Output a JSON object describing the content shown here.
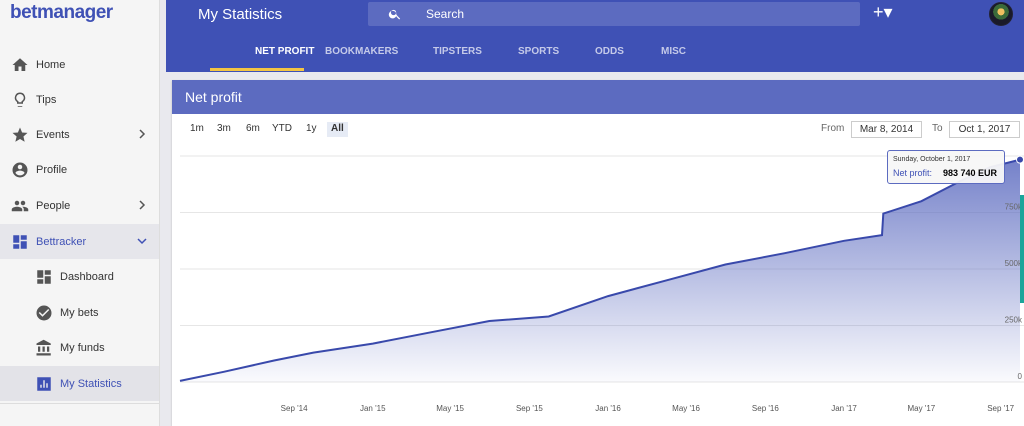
{
  "app": {
    "logo": "betmanager"
  },
  "sidebar": {
    "items": [
      {
        "label": "Home",
        "icon": "home-icon"
      },
      {
        "label": "Tips",
        "icon": "lightbulb-icon"
      },
      {
        "label": "Events",
        "icon": "star-icon",
        "has_chevron": true
      },
      {
        "label": "Profile",
        "icon": "account-icon"
      },
      {
        "label": "People",
        "icon": "people-icon",
        "has_chevron": true
      },
      {
        "label": "Bettracker",
        "icon": "dashboard-icon",
        "expanded": true
      },
      {
        "label": "Dashboard",
        "icon": "dashboard-icon",
        "sub": true
      },
      {
        "label": "My bets",
        "icon": "check-circle-icon",
        "sub": true
      },
      {
        "label": "My funds",
        "icon": "bank-icon",
        "sub": true
      },
      {
        "label": "My Statistics",
        "icon": "bar-chart-icon",
        "sub": true,
        "active": true
      }
    ]
  },
  "header": {
    "title": "My Statistics",
    "search_placeholder": "Search",
    "add_label": "+▾",
    "tabs": [
      {
        "label": "NET PROFIT",
        "active": true
      },
      {
        "label": "BOOKMAKERS"
      },
      {
        "label": "TIPSTERS"
      },
      {
        "label": "SPORTS"
      },
      {
        "label": "ODDS"
      },
      {
        "label": "MISC"
      }
    ]
  },
  "card": {
    "title": "Net profit",
    "range_buttons": [
      "1m",
      "3m",
      "6m",
      "YTD",
      "1y",
      "All"
    ],
    "active_range": "All",
    "from_label": "From",
    "from_value": "Mar 8, 2014",
    "to_label": "To",
    "to_value": "Oct 1, 2017",
    "tooltip": {
      "date": "Sunday, October 1, 2017",
      "label": "Net profit:",
      "value": "983 740 EUR"
    }
  },
  "colors": {
    "accent": "#3f51b5",
    "header_light": "#5c6bc0",
    "highlight": "#f4c542",
    "line": "#3949ab",
    "teal": "#1aa59a"
  },
  "chart_data": {
    "type": "area",
    "x_ticks": [
      "Sep '14",
      "Jan '15",
      "May '15",
      "Sep '15",
      "Jan '16",
      "May '16",
      "Sep '16",
      "Jan '17",
      "May '17",
      "Sep '17"
    ],
    "y_ticks": [
      "0",
      "250k",
      "500k",
      "750k"
    ],
    "ylim": [
      0,
      1000000
    ],
    "xlim": [
      "2014-03-08",
      "2017-10-01"
    ],
    "legend": "none",
    "grid": true,
    "series": [
      {
        "x": [
          "2014-03-08",
          "2014-05-15",
          "2014-08-01",
          "2014-10-01",
          "2015-01-01",
          "2015-04-01",
          "2015-07-01",
          "2015-10-01",
          "2016-01-01",
          "2016-04-01",
          "2016-07-01",
          "2016-10-01",
          "2017-01-01",
          "2017-03-01",
          "2017-03-03",
          "2017-05-01",
          "2017-07-01",
          "2017-08-15",
          "2017-10-01"
        ],
        "values": [
          5000,
          45000,
          95000,
          130000,
          170000,
          220000,
          270000,
          290000,
          380000,
          450000,
          520000,
          570000,
          625000,
          650000,
          745000,
          800000,
          890000,
          950000,
          983740
        ]
      }
    ]
  }
}
